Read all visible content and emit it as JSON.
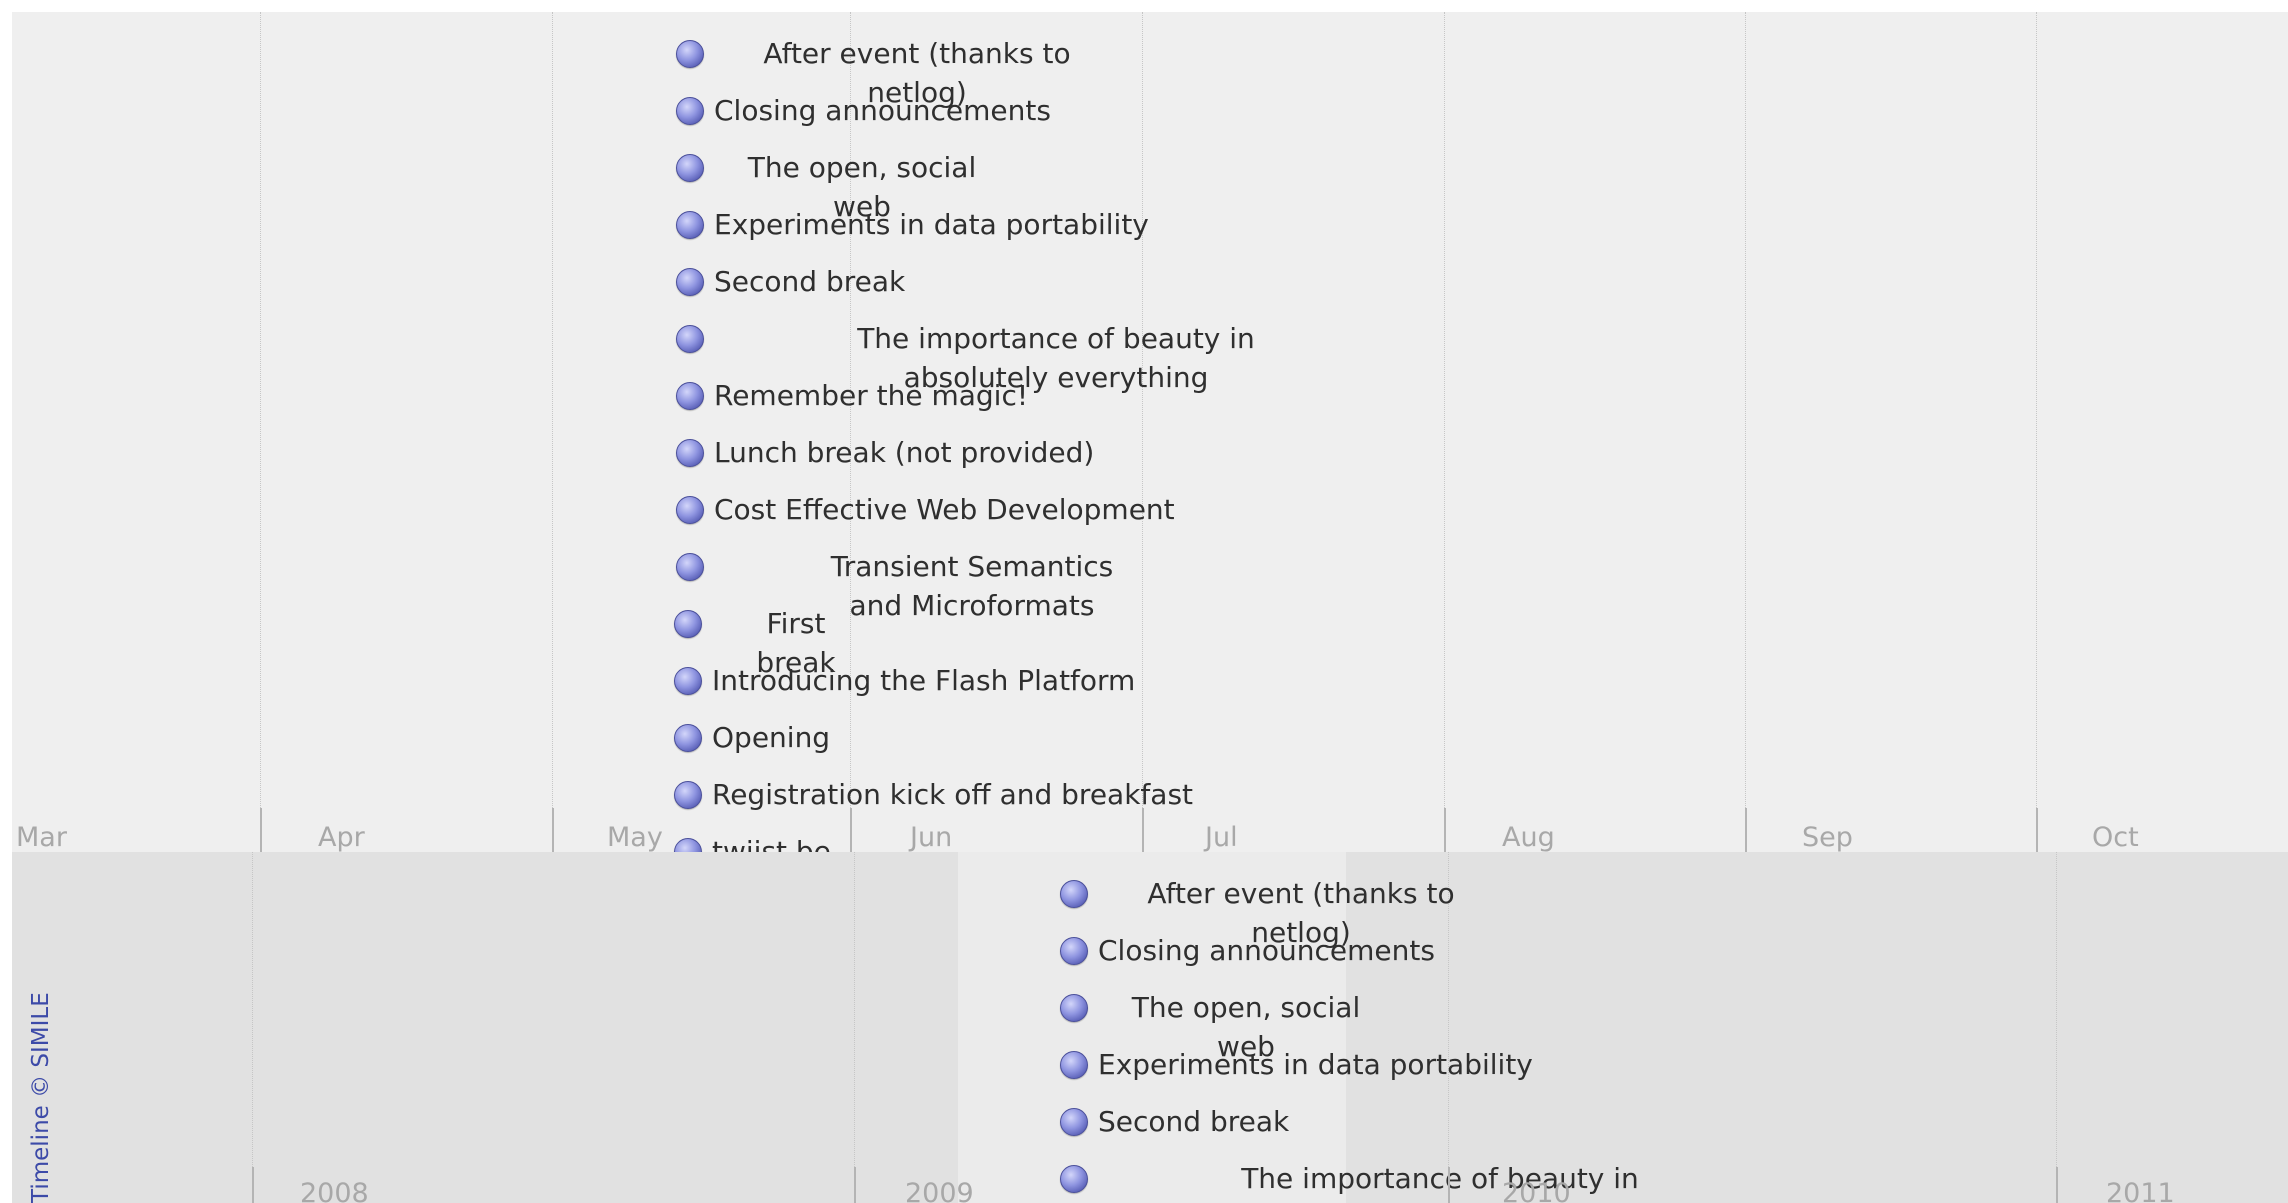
{
  "top_band": {
    "month_labels": [
      "Mar",
      "Apr",
      "May",
      "Jun",
      "Jul",
      "Aug",
      "Sep",
      "Oct"
    ],
    "events": [
      {
        "title": "After event (thanks to netlog)"
      },
      {
        "title": "Closing announcements"
      },
      {
        "title": "The open, social web"
      },
      {
        "title": "Experiments in data portability"
      },
      {
        "title": "Second break"
      },
      {
        "title": "The importance of beauty in absolutely everything"
      },
      {
        "title": "Remember the magic!"
      },
      {
        "title": "Lunch break (not provided)"
      },
      {
        "title": "Cost Effective Web Development"
      },
      {
        "title": "Transient Semantics and Microformats"
      },
      {
        "title": "First break"
      },
      {
        "title": "Introducing the Flash Platform"
      },
      {
        "title": "Opening"
      },
      {
        "title": "Registration kick off and breakfast"
      },
      {
        "title": "twiist.be"
      }
    ]
  },
  "bottom_band": {
    "year_labels": [
      "2008",
      "2009",
      "2010",
      "2011"
    ],
    "events": [
      {
        "title": "After event (thanks to netlog)"
      },
      {
        "title": "Closing announcements"
      },
      {
        "title": "The open, social web"
      },
      {
        "title": "Experiments in data portability"
      },
      {
        "title": "Second break"
      },
      {
        "title": "The importance of beauty in absolutely everything"
      }
    ]
  },
  "credit": "Timeline © SIMILE",
  "colors": {
    "top_band_bg": "#efefef",
    "bottom_band_bg": "#e1e1e1",
    "event_dot": "#6a70c8",
    "credit_text": "#3c4aa8"
  }
}
